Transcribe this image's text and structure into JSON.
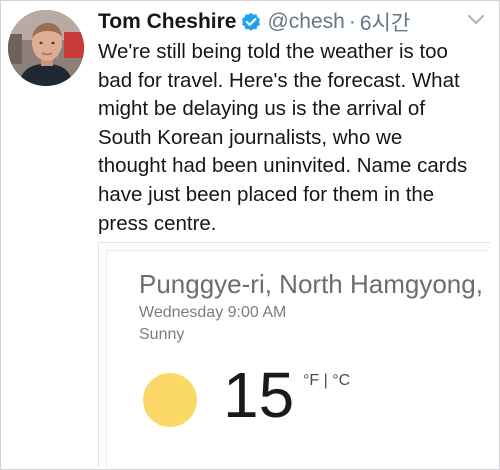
{
  "tweet": {
    "author": {
      "name": "Tom Cheshire",
      "handle": "@chesh",
      "separator": "·",
      "time": "6시간"
    },
    "lines": [
      "We're still being told the weather is too",
      "bad for travel. Here's the forecast. What",
      "might be delaying us is the arrival of",
      "South Korean journalists, who we",
      "thought had been uninvited. Name cards",
      "have just been placed for them in the",
      "press centre."
    ]
  },
  "weather_card": {
    "location": "Punggye-ri, North Hamgyong,",
    "datetime": "Wednesday 9:00 AM",
    "condition": "Sunny",
    "temperature": "15",
    "units": "°F | °C",
    "icon": "sun-icon"
  },
  "icons": {
    "verified": "verified-badge-icon",
    "menu": "caret-down-icon"
  },
  "colors": {
    "verified": "#1da1f2",
    "secondary_text": "#657786",
    "sun": "#fbd868"
  }
}
